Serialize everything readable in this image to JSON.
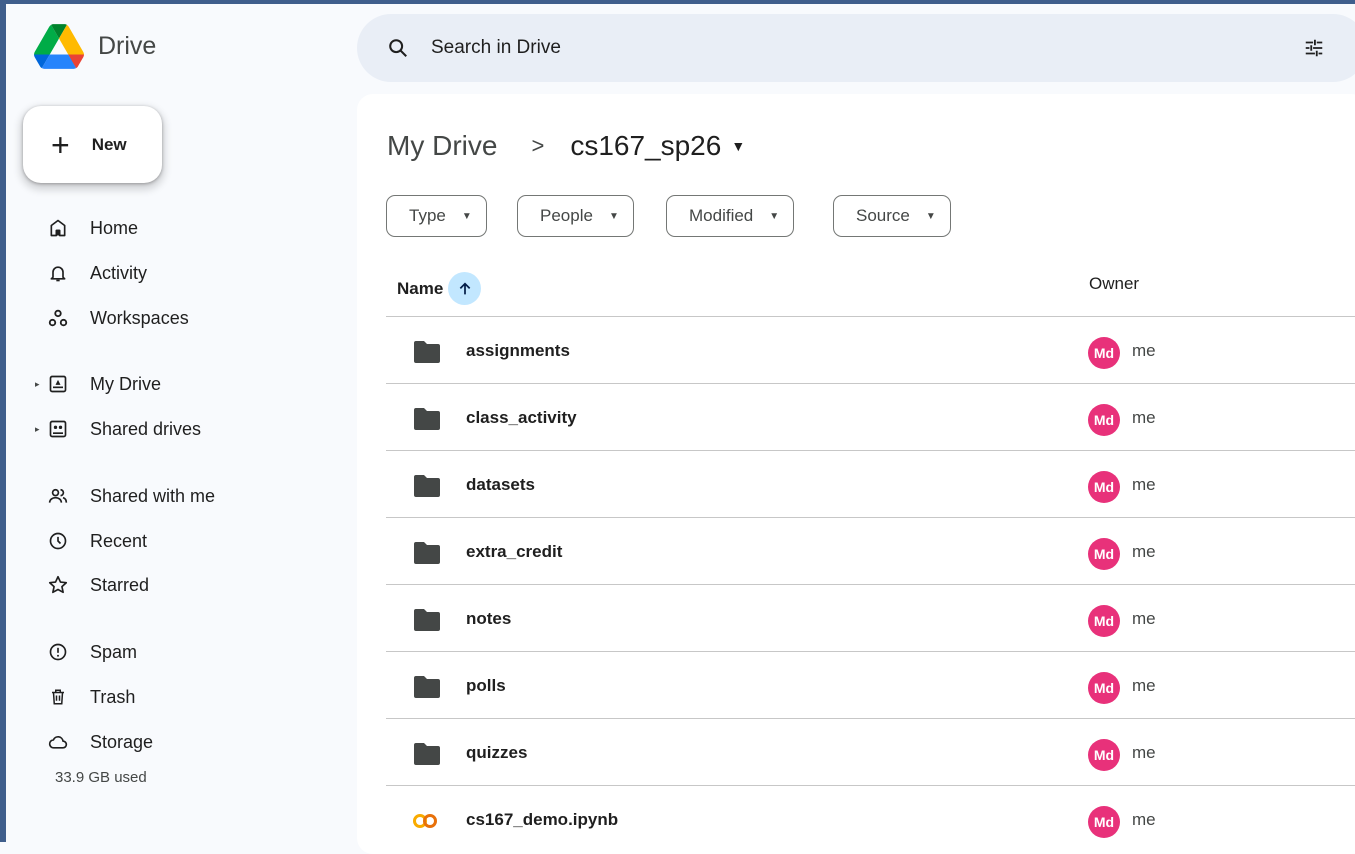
{
  "app": {
    "name": "Drive"
  },
  "sidebar": {
    "new_label": "New",
    "items": [
      {
        "label": "Home",
        "icon": "home-icon"
      },
      {
        "label": "Activity",
        "icon": "bell-icon"
      },
      {
        "label": "Workspaces",
        "icon": "workspaces-icon"
      },
      {
        "label": "My Drive",
        "icon": "my-drive-icon"
      },
      {
        "label": "Shared drives",
        "icon": "shared-drives-icon"
      },
      {
        "label": "Shared with me",
        "icon": "people-icon"
      },
      {
        "label": "Recent",
        "icon": "clock-icon"
      },
      {
        "label": "Starred",
        "icon": "star-icon"
      },
      {
        "label": "Spam",
        "icon": "spam-icon"
      },
      {
        "label": "Trash",
        "icon": "trash-icon"
      },
      {
        "label": "Storage",
        "icon": "cloud-icon"
      }
    ],
    "storage_used": "33.9 GB used"
  },
  "search": {
    "placeholder": "Search in Drive"
  },
  "breadcrumb": {
    "root": "My Drive",
    "current": "cs167_sp26"
  },
  "filters": [
    "Type",
    "People",
    "Modified",
    "Source"
  ],
  "table": {
    "headers": {
      "name": "Name",
      "owner": "Owner"
    },
    "rows": [
      {
        "name": "assignments",
        "type": "folder",
        "owner_initials": "Md",
        "owner": "me"
      },
      {
        "name": "class_activity",
        "type": "folder",
        "owner_initials": "Md",
        "owner": "me"
      },
      {
        "name": "datasets",
        "type": "folder",
        "owner_initials": "Md",
        "owner": "me"
      },
      {
        "name": "extra_credit",
        "type": "folder",
        "owner_initials": "Md",
        "owner": "me"
      },
      {
        "name": "notes",
        "type": "folder",
        "owner_initials": "Md",
        "owner": "me"
      },
      {
        "name": "polls",
        "type": "folder",
        "owner_initials": "Md",
        "owner": "me"
      },
      {
        "name": "quizzes",
        "type": "folder",
        "owner_initials": "Md",
        "owner": "me"
      },
      {
        "name": "cs167_demo.ipynb",
        "type": "colab",
        "owner_initials": "Md",
        "owner": "me"
      }
    ]
  },
  "colors": {
    "accent": "#c2e7ff",
    "avatar": "#e8317a",
    "colab": "#f9ab00"
  }
}
